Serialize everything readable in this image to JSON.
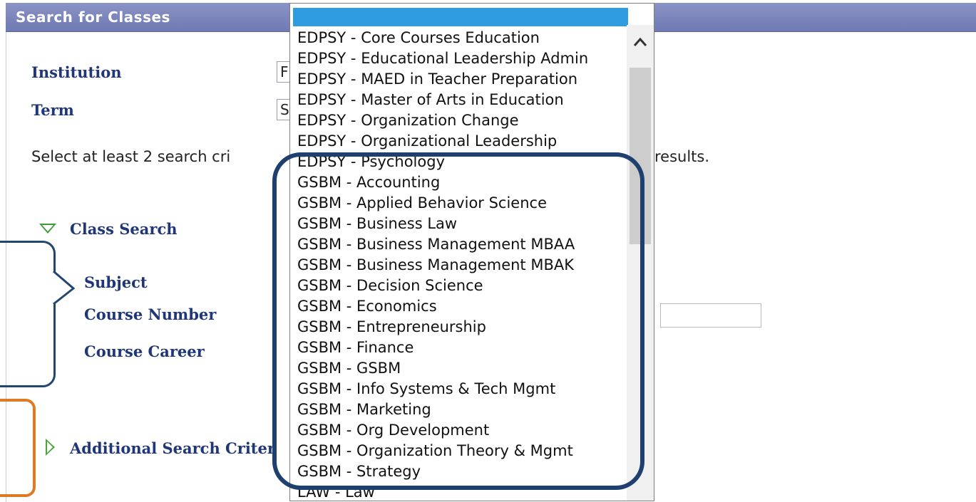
{
  "panel": {
    "title": "Search for Classes"
  },
  "form": {
    "institution_label": "Institution",
    "institution_value": "F",
    "term_label": "Term",
    "term_value": "S",
    "instruction_left": "Select at least 2 search cri",
    "instruction_right": "results.",
    "class_search_label": "Class Search",
    "subject_label": "Subject",
    "course_number_label": "Course Number",
    "course_career_label": "Course Career",
    "additional_label": "Additional Search Criter"
  },
  "subject_dropdown": {
    "options": [
      "EDPSY - Core Courses Education",
      "EDPSY - Educational Leadership Admin",
      "EDPSY - MAED in Teacher Preparation",
      "EDPSY - Master of Arts in Education",
      "EDPSY - Organization Change",
      "EDPSY - Organizational Leadership",
      "EDPSY - Psychology",
      "GSBM - Accounting",
      "GSBM - Applied Behavior Science",
      "GSBM - Business Law",
      "GSBM - Business Management MBAA",
      "GSBM - Business Management MBAK",
      "GSBM - Decision Science",
      "GSBM - Economics",
      "GSBM - Entrepreneurship",
      "GSBM - Finance",
      "GSBM - GSBM",
      "GSBM - Info Systems & Tech Mgmt",
      "GSBM - Marketing",
      "GSBM - Org Development",
      "GSBM - Organization Theory & Mgmt",
      "GSBM - Strategy",
      "LAW - Law"
    ]
  },
  "icons": {
    "expand": "triangle-down-icon",
    "collapse": "triangle-right-icon",
    "scroll_up": "chevron-up-icon"
  },
  "colors": {
    "title_bar": "#7a84bb",
    "label": "#1f3677",
    "selected_option": "#2f9be0",
    "highlight_box": "#1f3f6e",
    "orange_box": "#de7a23"
  }
}
